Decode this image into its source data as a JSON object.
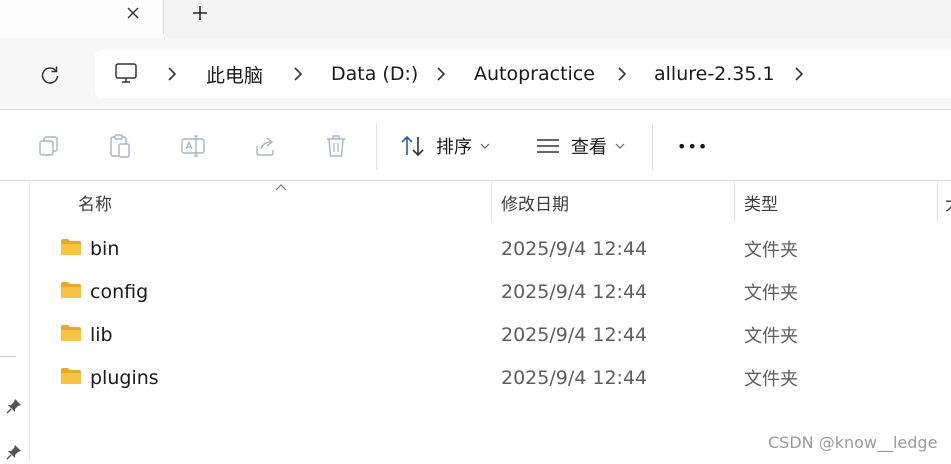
{
  "tabbar": {
    "close_icon": "close-icon",
    "new_tab_icon": "plus-icon"
  },
  "address": {
    "refresh_icon": "refresh-icon",
    "computer_icon": "monitor-icon",
    "crumbs": [
      "此电脑",
      "Data (D:)",
      "Autopractice",
      "allure-2.35.1"
    ]
  },
  "toolbar": {
    "icons": [
      "copy-icon",
      "paste-icon",
      "rename-icon",
      "share-icon",
      "delete-icon"
    ],
    "sort_label": "排序",
    "view_label": "查看",
    "more_label": "•••"
  },
  "columns": {
    "name": "名称",
    "date": "修改日期",
    "type": "类型",
    "size_partial": "大"
  },
  "files": [
    {
      "name": "bin",
      "date": "2025/9/4 12:44",
      "type": "文件夹"
    },
    {
      "name": "config",
      "date": "2025/9/4 12:44",
      "type": "文件夹"
    },
    {
      "name": "lib",
      "date": "2025/9/4 12:44",
      "type": "文件夹"
    },
    {
      "name": "plugins",
      "date": "2025/9/4 12:44",
      "type": "文件夹"
    }
  ],
  "watermark": "CSDN @know__ledge",
  "colors": {
    "folder": "#f6c343",
    "folder_dark": "#e7a92b",
    "icon_gray": "#a9b4c2"
  }
}
